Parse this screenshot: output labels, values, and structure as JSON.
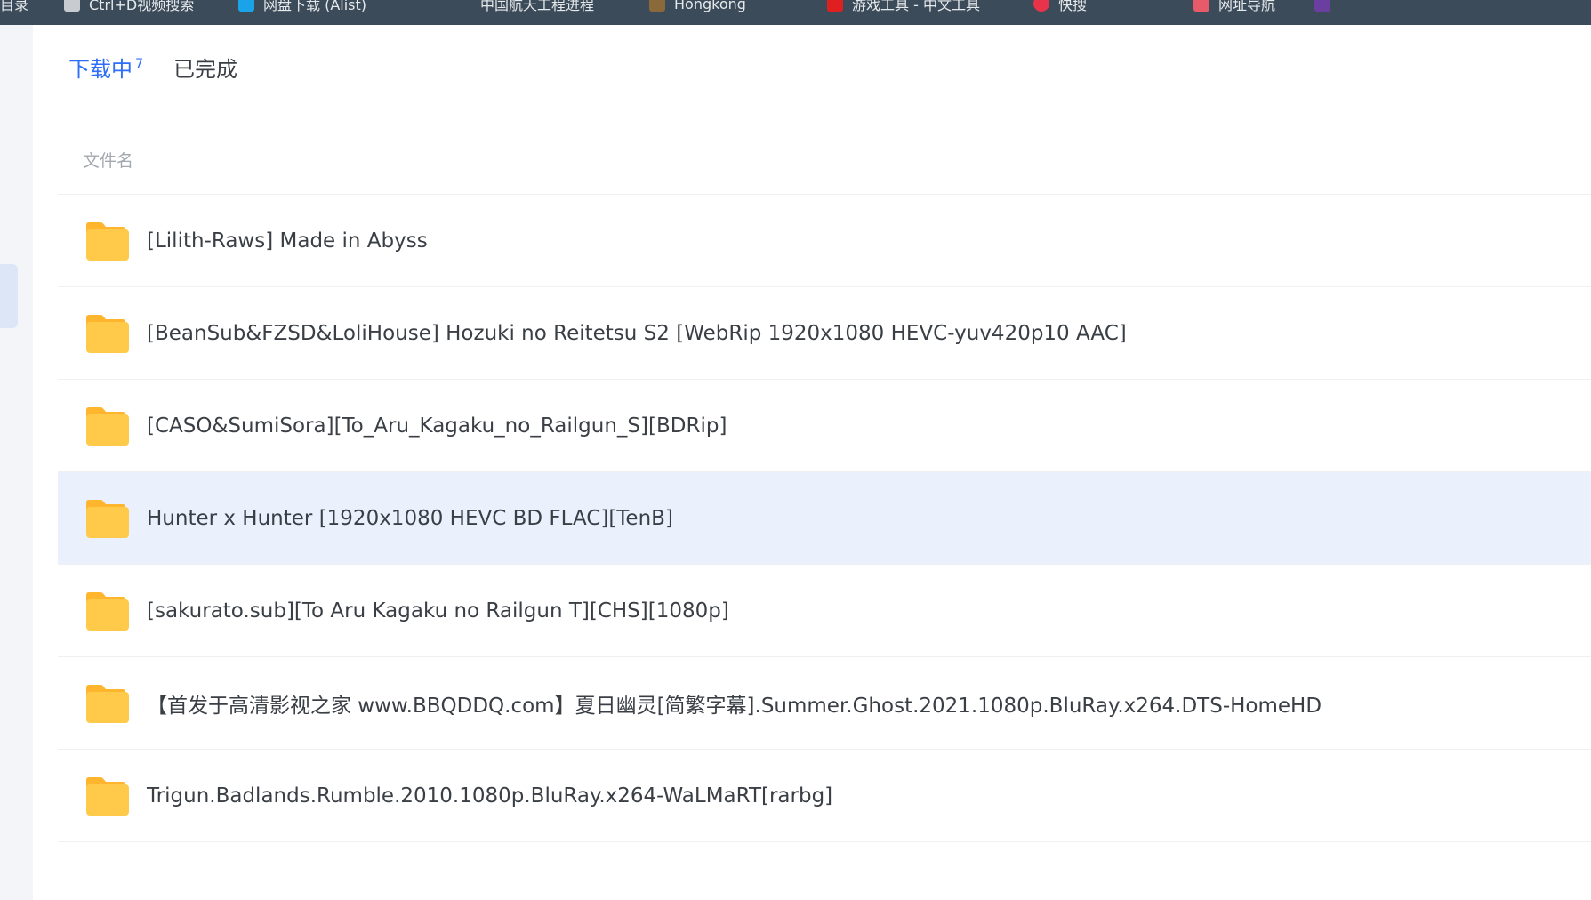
{
  "browser": {
    "bookmarks": [
      {
        "label": "目录",
        "icon": "folder-icon",
        "color": "#3c4b59"
      },
      {
        "label": "Ctrl+D视频搜索",
        "icon": "page-icon",
        "color": "#c8ccd1"
      },
      {
        "label": "网盘下载 (Alist)",
        "icon": "app-icon",
        "color": "#1aa3e8"
      },
      {
        "label": "中国航天工程进程",
        "icon": "none",
        "color": "#3c4b59"
      },
      {
        "label": "Hongkong",
        "icon": "app-icon",
        "color": "#8a6a3a"
      },
      {
        "label": "游戏工具 - 中文工具",
        "icon": "app-icon",
        "color": "#e02020"
      },
      {
        "label": "快搜",
        "icon": "circle-icon",
        "color": "#e8334a"
      },
      {
        "label": "网址导航",
        "icon": "app-icon",
        "color": "#e65a6a"
      },
      {
        "label": "",
        "icon": "app-icon",
        "color": "#6b3fa0"
      }
    ]
  },
  "tabs": [
    {
      "label": "下载中",
      "badge": "7",
      "active": true
    },
    {
      "label": "已完成",
      "badge": "",
      "active": false
    }
  ],
  "table": {
    "column_header": "文件名",
    "rows": [
      {
        "name": "[Lilith-Raws] Made in Abyss",
        "icon": "folder-icon",
        "selected": false
      },
      {
        "name": "[BeanSub&FZSD&LoliHouse] Hozuki no Reitetsu S2 [WebRip 1920x1080 HEVC-yuv420p10 AAC]",
        "icon": "folder-icon",
        "selected": false
      },
      {
        "name": "[CASO&SumiSora][To_Aru_Kagaku_no_Railgun_S][BDRip]",
        "icon": "folder-icon",
        "selected": false
      },
      {
        "name": "Hunter x Hunter [1920x1080 HEVC BD FLAC][TenB]",
        "icon": "folder-icon",
        "selected": true
      },
      {
        "name": "[sakurato.sub][To Aru Kagaku no Railgun T][CHS][1080p]",
        "icon": "folder-icon",
        "selected": false
      },
      {
        "name": "【首发于高清影视之家 www.BBQDDQ.com】夏日幽灵[简繁字幕].Summer.Ghost.2021.1080p.BluRay.x264.DTS-HomeHD",
        "icon": "folder-icon",
        "selected": false
      },
      {
        "name": "Trigun.Badlands.Rumble.2010.1080p.BluRay.x264-WaLMaRT[rarbg]",
        "icon": "folder-icon",
        "selected": false
      }
    ]
  },
  "colors": {
    "accent": "#2f6ef6",
    "selected_row": "#eaf1fd",
    "folder_body": "#ffc94a",
    "folder_tab": "#ffb52e"
  }
}
